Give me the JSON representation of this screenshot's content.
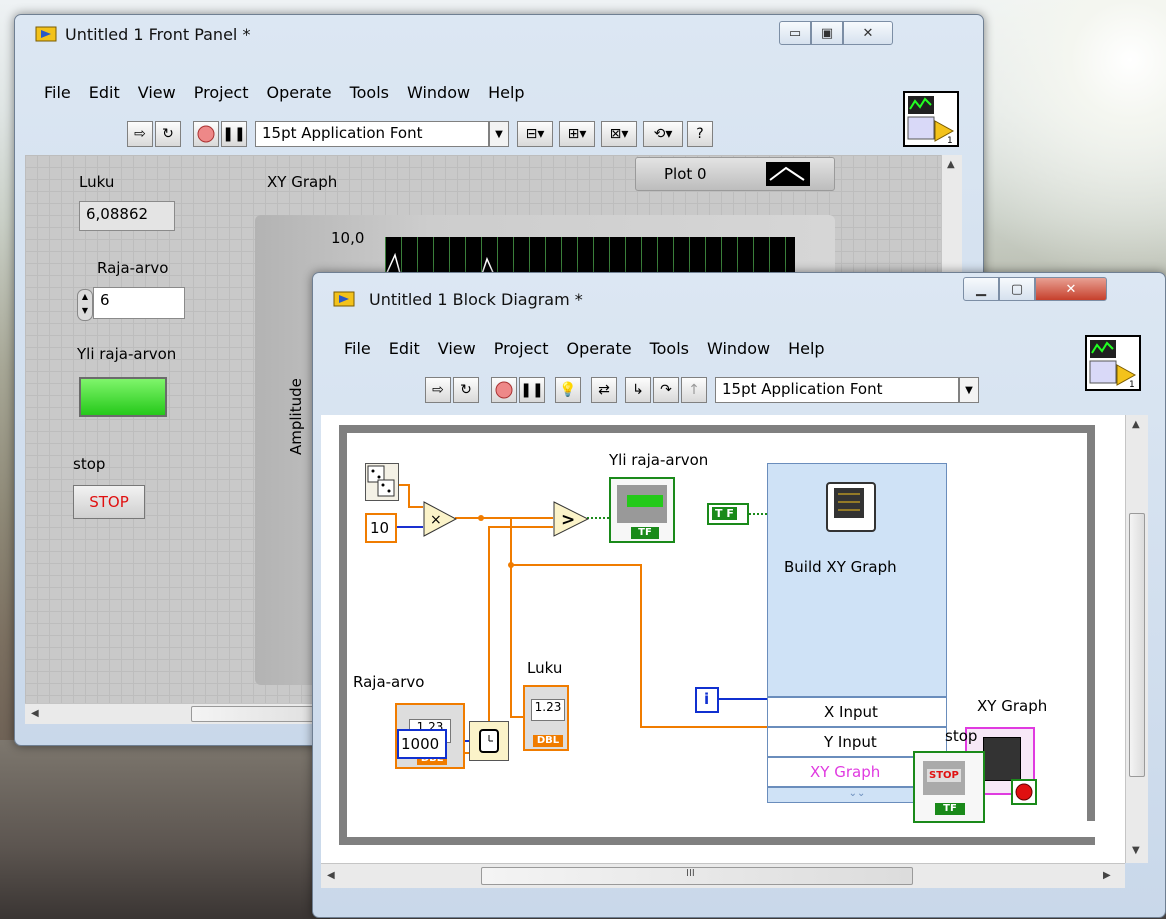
{
  "front_panel": {
    "title": "Untitled 1 Front Panel *",
    "menu": [
      "File",
      "Edit",
      "View",
      "Project",
      "Operate",
      "Tools",
      "Window",
      "Help"
    ],
    "font_selector": "15pt Application Font",
    "controls": {
      "luku_label": "Luku",
      "luku_value": "6,08862",
      "raja_label": "Raja-arvo",
      "raja_value": "6",
      "yli_label": "Yli raja-arvon",
      "stop_label": "stop",
      "stop_button": "STOP"
    },
    "graph": {
      "label": "XY Graph",
      "plot_legend": "Plot 0",
      "y_tick_top": "10,0",
      "y_axis_label": "Amplitude"
    },
    "led_color": "#33dd22"
  },
  "block_diagram": {
    "title": "Untitled 1 Block Diagram *",
    "menu": [
      "File",
      "Edit",
      "View",
      "Project",
      "Operate",
      "Tools",
      "Window",
      "Help"
    ],
    "font_selector": "15pt Application Font",
    "nodes": {
      "const_10": "10",
      "const_1000": "1000",
      "yli_label": "Yli raja-arvon",
      "luku_label": "Luku",
      "raja_label": "Raja-arvo",
      "indicator_value": "1.23",
      "dbl_tag": "DBL",
      "tf_tag": "TF",
      "bool_const": "T F",
      "iteration": "i",
      "build_xy_label": "Build XY Graph",
      "x_input": "X Input",
      "y_input": "Y Input",
      "xy_graph_terminal": "XY Graph",
      "xy_graph_label": "XY Graph",
      "stop_label": "stop",
      "stop_button": "STOP"
    },
    "wire_colors": {
      "numeric": "#f07c00",
      "boolean": "#1a8a1a",
      "integer": "#1030d0",
      "cluster": "#e03ae0"
    }
  },
  "scroll_marks": {
    "h_thumb_grip": "III"
  }
}
